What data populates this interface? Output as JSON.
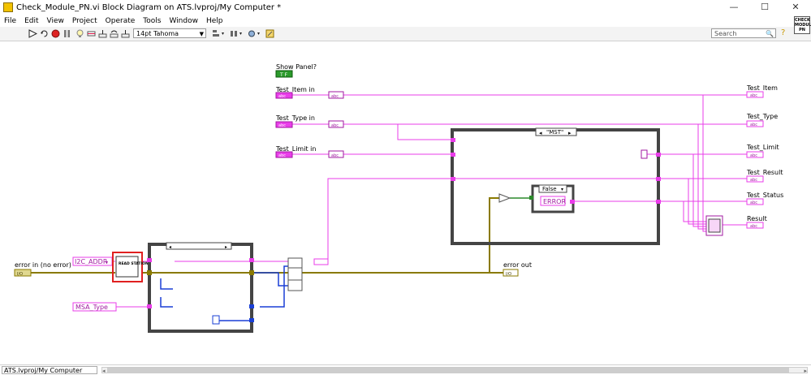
{
  "window": {
    "title": "Check_Module_PN.vi Block Diagram on ATS.lvproj/My Computer *",
    "minimize": "—",
    "maximize": "☐",
    "close": "✕"
  },
  "menu": [
    "File",
    "Edit",
    "View",
    "Project",
    "Operate",
    "Tools",
    "Window",
    "Help"
  ],
  "toolbar": {
    "font": "14pt Tahoma",
    "search_placeholder": "Search",
    "help": "?",
    "connector_label": "CHECK MODULE PN"
  },
  "diagram": {
    "labels": {
      "show_panel": "Show Panel?",
      "show_panel_const": "T F",
      "test_item_in": "Test_Item in",
      "test_type_in": "Test_Type in",
      "test_limit_in": "Test_Limit in",
      "error_in": "error in (no error)",
      "error_out": "error out",
      "test_item": "Test_Item",
      "test_type": "Test_Type",
      "test_limit": "Test_Limit",
      "test_result": "Test_Result",
      "test_status": "Test_Status",
      "result": "Result"
    },
    "terminals": {
      "string": "abc",
      "abc_conv": "abc",
      "error_cluster": "I/O"
    },
    "constants": {
      "i2c_addr": "I2C_ADDR",
      "msa_type": "MSA_Type",
      "read_station": "READ STATION",
      "error_str": "ERROR"
    },
    "cases": {
      "outer": "\"MST\"",
      "inner": "False"
    }
  },
  "statusbar": {
    "context": "ATS.lvproj/My Computer"
  }
}
